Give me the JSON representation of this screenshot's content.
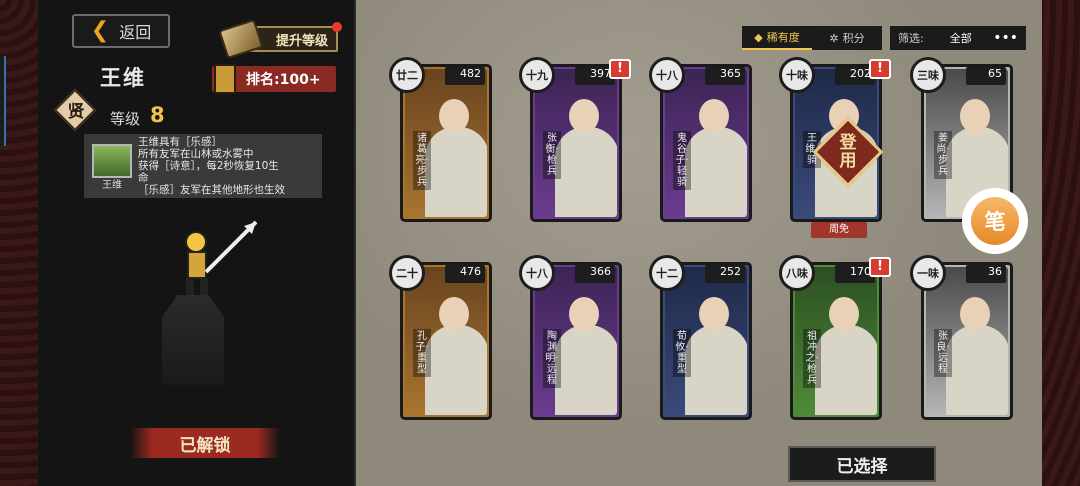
{
  "header": {
    "back_label": "返回",
    "upgrade_label": "提升等级"
  },
  "hero": {
    "name": "王维",
    "grade": "贤",
    "level_label": "等级",
    "level_value": "8",
    "rank_label": "排名:100+",
    "skill_lines": [
      "王维具有［乐感］",
      "所有友军在山林或水雾中",
      "获得［诗意］，每2秒恢复10生",
      "命",
      "［乐感］友军在其他地形也生效"
    ],
    "skill_icon_name": "王维",
    "status_label": "已解锁"
  },
  "sort": {
    "tabs": [
      "稀有度",
      "积分"
    ],
    "active": "稀有度",
    "filter_label": "筛选:",
    "filter_value": "全部",
    "more": "•••"
  },
  "cards": [
    {
      "badge": "廿二",
      "cost": "482",
      "label": "诸葛亮·步兵",
      "theme": "#a8752f",
      "bg": "#6a4420",
      "alert": false
    },
    {
      "badge": "十九",
      "cost": "397",
      "label": "张衡·枪兵",
      "theme": "#6a3b8f",
      "bg": "#3c2455",
      "alert": true
    },
    {
      "badge": "十八",
      "cost": "365",
      "label": "鬼谷子·轻骑",
      "theme": "#6a3b8f",
      "bg": "#3c2455",
      "alert": false
    },
    {
      "badge": "十味",
      "cost": "202",
      "label": "王维·骑",
      "theme": "#3a4a7a",
      "bg": "#1f2a48",
      "alert": true,
      "equipped": "登用",
      "week_free": "周免"
    },
    {
      "badge": "三味",
      "cost": "65",
      "label": "姜尚·步兵",
      "theme": "#b5b5b5",
      "bg": "#4a4a4a",
      "alert": false
    },
    {
      "badge": "二十",
      "cost": "476",
      "label": "孔子·重型",
      "theme": "#a8752f",
      "bg": "#6a4420",
      "alert": false
    },
    {
      "badge": "十八",
      "cost": "366",
      "label": "陶渊明·远程",
      "theme": "#6a3b8f",
      "bg": "#3c2455",
      "alert": false
    },
    {
      "badge": "十二",
      "cost": "252",
      "label": "荀攸·重型",
      "theme": "#3a4a7a",
      "bg": "#1f2a48",
      "alert": false
    },
    {
      "badge": "八味",
      "cost": "170",
      "label": "祖冲之·枪兵",
      "theme": "#4f8a3a",
      "bg": "#2c4f22",
      "alert": true
    },
    {
      "badge": "一味",
      "cost": "36",
      "label": "张良·远程",
      "theme": "#b5b5b5",
      "bg": "#4a4a4a",
      "alert": false
    }
  ],
  "pen_label": "笔",
  "select_label": "已选择",
  "colors": {
    "gold": "#f3c64e",
    "red": "#a3362b",
    "bg": "#141414"
  }
}
